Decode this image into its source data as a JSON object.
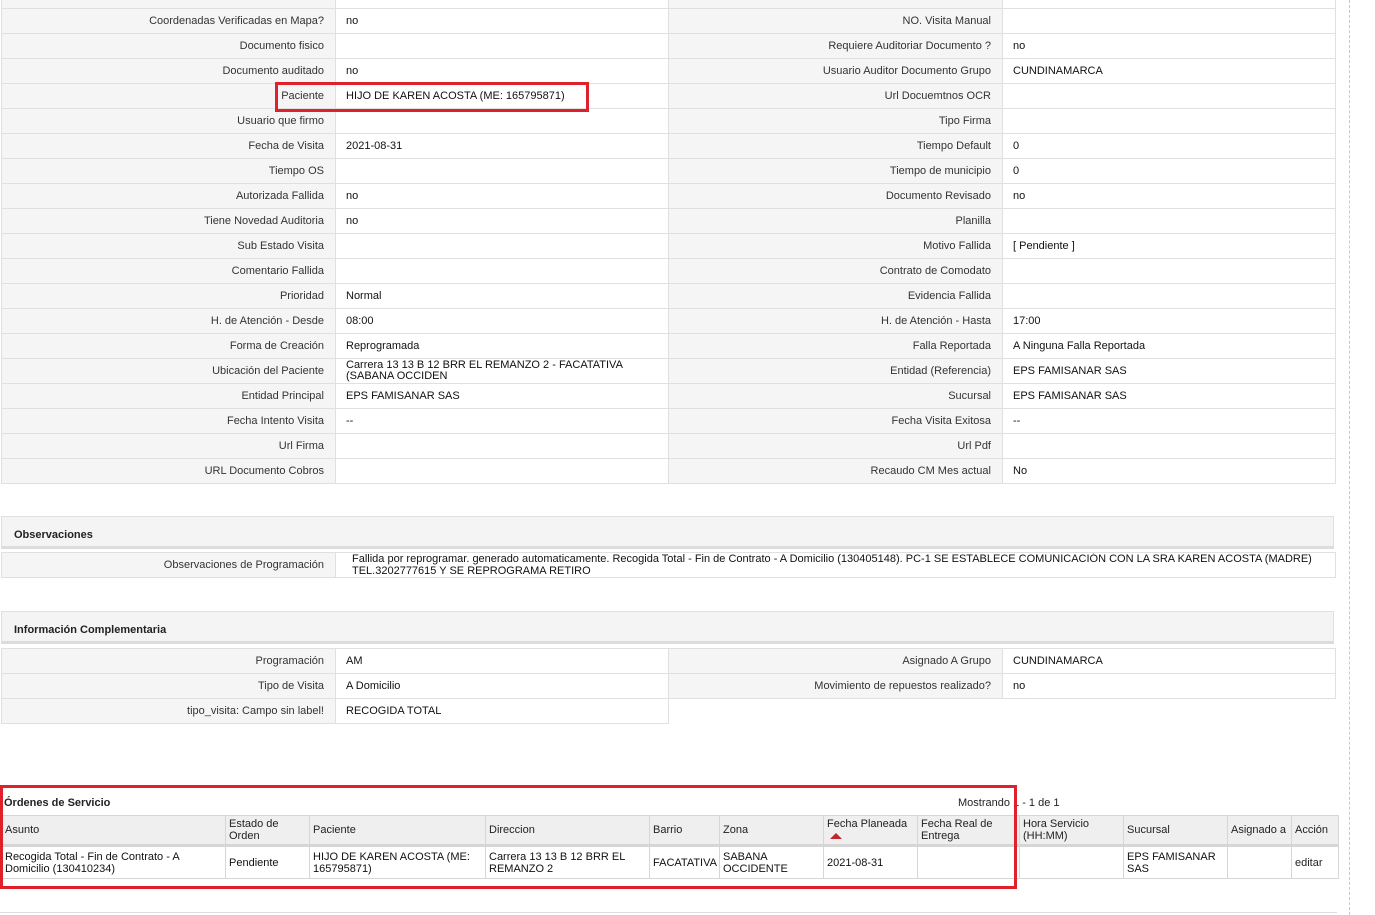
{
  "details": [
    [
      "Coordenadas Verificadas en Mapa?",
      "no",
      "NO. Visita Manual",
      ""
    ],
    [
      "Documento fisico",
      "",
      "Requiere Auditoriar Documento ?",
      "no"
    ],
    [
      "Documento auditado",
      "no",
      "Usuario Auditor Documento Grupo",
      "CUNDINAMARCA"
    ],
    [
      "Paciente",
      "HIJO DE KAREN ACOSTA (ME: 165795871)",
      "Url Docuemtnos OCR",
      ""
    ],
    [
      "Usuario que firmo",
      "",
      "Tipo Firma",
      ""
    ],
    [
      "Fecha de Visita",
      "2021-08-31",
      "Tiempo Default",
      "0"
    ],
    [
      "Tiempo OS",
      "",
      "Tiempo de municipio",
      "0"
    ],
    [
      "Autorizada Fallida",
      "no",
      "Documento Revisado",
      "no"
    ],
    [
      "Tiene Novedad Auditoria",
      "no",
      "Planilla",
      ""
    ],
    [
      "Sub Estado Visita",
      "",
      "Motivo Fallida",
      "[ Pendiente ]"
    ],
    [
      "Comentario Fallida",
      "",
      "Contrato de Comodato",
      ""
    ],
    [
      "Prioridad",
      "Normal",
      "Evidencia Fallida",
      ""
    ],
    [
      "H. de Atención - Desde",
      "08:00",
      "H. de Atención - Hasta",
      "17:00"
    ],
    [
      "Forma de Creación",
      "Reprogramada",
      "Falla Reportada",
      "A Ninguna Falla Reportada"
    ],
    [
      "Ubicación del Paciente",
      "Carrera 13 13 B 12 BRR EL REMANZO 2 - FACATATIVA (SABANA OCCIDEN",
      "Entidad (Referencia)",
      "EPS FAMISANAR SAS"
    ],
    [
      "Entidad Principal",
      "EPS FAMISANAR SAS",
      "Sucursal",
      "EPS FAMISANAR SAS"
    ],
    [
      "Fecha Intento Visita",
      "--",
      "Fecha Visita Exitosa",
      "--"
    ],
    [
      "Url Firma",
      "",
      "Url Pdf",
      ""
    ],
    [
      "URL Documento Cobros",
      "",
      "Recaudo CM Mes actual",
      "No"
    ]
  ],
  "observaciones": {
    "title": "Observaciones",
    "label": "Observaciones de Programación",
    "value": "Fallida por reprogramar. generado automaticamente. Recogida Total - Fin de Contrato - A Domicilio (130405148). PC-1 SE ESTABLECE COMUNICACIÓN CON LA SRA KAREN ACOSTA (MADRE) TEL.3202777615 Y SE REPROGRAMA RETIRO"
  },
  "complementaria": {
    "title": "Información Complementaria",
    "rows": [
      [
        "Programación",
        "AM",
        "Asignado A Grupo",
        "CUNDINAMARCA"
      ],
      [
        "Tipo de Visita",
        "A Domicilio",
        "Movimiento de repuestos realizado?",
        "no"
      ],
      [
        "tipo_visita: Campo sin label!",
        "RECOGIDA TOTAL"
      ]
    ]
  },
  "ordenes": {
    "title": "Órdenes de Servicio",
    "pagination": "Mostrando 1 - 1 de 1",
    "columns": [
      "Asunto",
      "Estado de Orden",
      "Paciente",
      "Direccion",
      "Barrio",
      "Zona",
      "Fecha Planeada",
      "Fecha Real de Entrega",
      "Hora Servicio (HH:MM)",
      "Sucursal",
      "Asignado a",
      "Acción"
    ],
    "sorted_column_icon": "sort-ascending-icon",
    "rows": [
      [
        "Recogida Total - Fin de Contrato - A Domicilio (130410234)",
        "Pendiente",
        "HIJO DE KAREN ACOSTA (ME: 165795871)",
        "Carrera 13 13 B 12 BRR EL REMANZO 2",
        "FACATATIVA",
        "SABANA OCCIDENTE",
        "2021-08-31",
        "",
        "",
        "EPS FAMISANAR SAS",
        "",
        "editar"
      ]
    ]
  },
  "colors": {
    "highlight": "#e0202a",
    "label_bg": "#f5f5f5",
    "sort_arrow": "#c0262d"
  }
}
